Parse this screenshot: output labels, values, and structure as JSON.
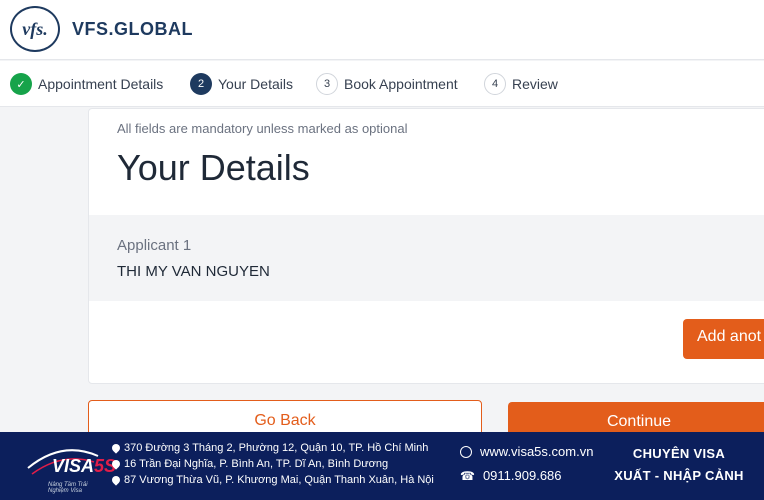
{
  "header": {
    "logo_mark": "vfs.",
    "brand": "VFS.GLOBAL"
  },
  "stepper": {
    "steps": [
      {
        "number": "✓",
        "label": "Appointment Details",
        "status": "done"
      },
      {
        "number": "2",
        "label": "Your Details",
        "status": "active"
      },
      {
        "number": "3",
        "label": "Book Appointment",
        "status": "pending"
      },
      {
        "number": "4",
        "label": "Review",
        "status": "pending"
      }
    ]
  },
  "form": {
    "hint": "All fields are mandatory unless marked as optional",
    "title": "Your Details",
    "applicant_label": "Applicant 1",
    "applicant_name": "THI MY VAN NGUYEN",
    "add_button": "Add anot"
  },
  "actions": {
    "back_label": "Go Back",
    "continue_label": "Continue"
  },
  "footer": {
    "brand_visa": "VISA",
    "brand_5s": "5S",
    "brand_slogan": "Nâng Tầm Trải Nghiệm Visa",
    "addresses": [
      "370 Đường 3 Tháng 2, Phường 12, Quận 10, TP. Hồ Chí Minh",
      "16 Trần Đại Nghĩa, P. Bình An, TP. Dĩ An, Bình Dương",
      "87 Vương Thừa Vũ, P. Khương Mai, Quận Thanh Xuân, Hà Nội"
    ],
    "website": "www.visa5s.com.vn",
    "phone": "0911.909.686",
    "slogan_1": "CHUYÊN VISA",
    "slogan_2": "XUẤT - NHẬP CẢNH"
  },
  "colors": {
    "accent": "#e35d1b",
    "brand_navy": "#1e3a5f",
    "footer_bg": "#0c1f5c",
    "success": "#16a34a"
  }
}
